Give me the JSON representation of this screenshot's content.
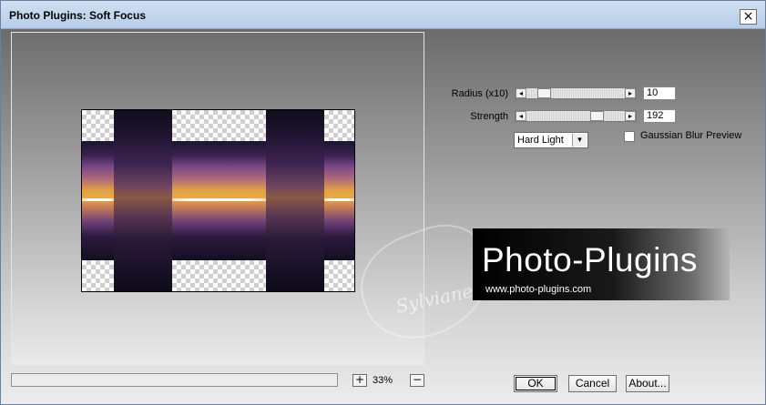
{
  "window": {
    "title": "Photo Plugins: Soft Focus",
    "close_glyph": "×"
  },
  "preview": {
    "zoom_in_label": "+",
    "zoom_out_label": "−",
    "zoom_value": "33%"
  },
  "controls": {
    "radius": {
      "label": "Radius (x10)",
      "value": "10",
      "slider_fraction": 0.13
    },
    "strength": {
      "label": "Strength",
      "value": "192",
      "slider_fraction": 0.75
    },
    "blend_mode": {
      "selected": "Hard Light"
    },
    "gaussian": {
      "label": "Gaussian Blur Preview",
      "checked": false
    }
  },
  "logo": {
    "title": "Photo-Plugins",
    "url": "www.photo-plugins.com"
  },
  "buttons": {
    "ok": "OK",
    "cancel": "Cancel",
    "about": "About..."
  },
  "icons": {
    "left_arrow": "◂",
    "right_arrow": "▸",
    "dropdown_arrow": "▼"
  }
}
